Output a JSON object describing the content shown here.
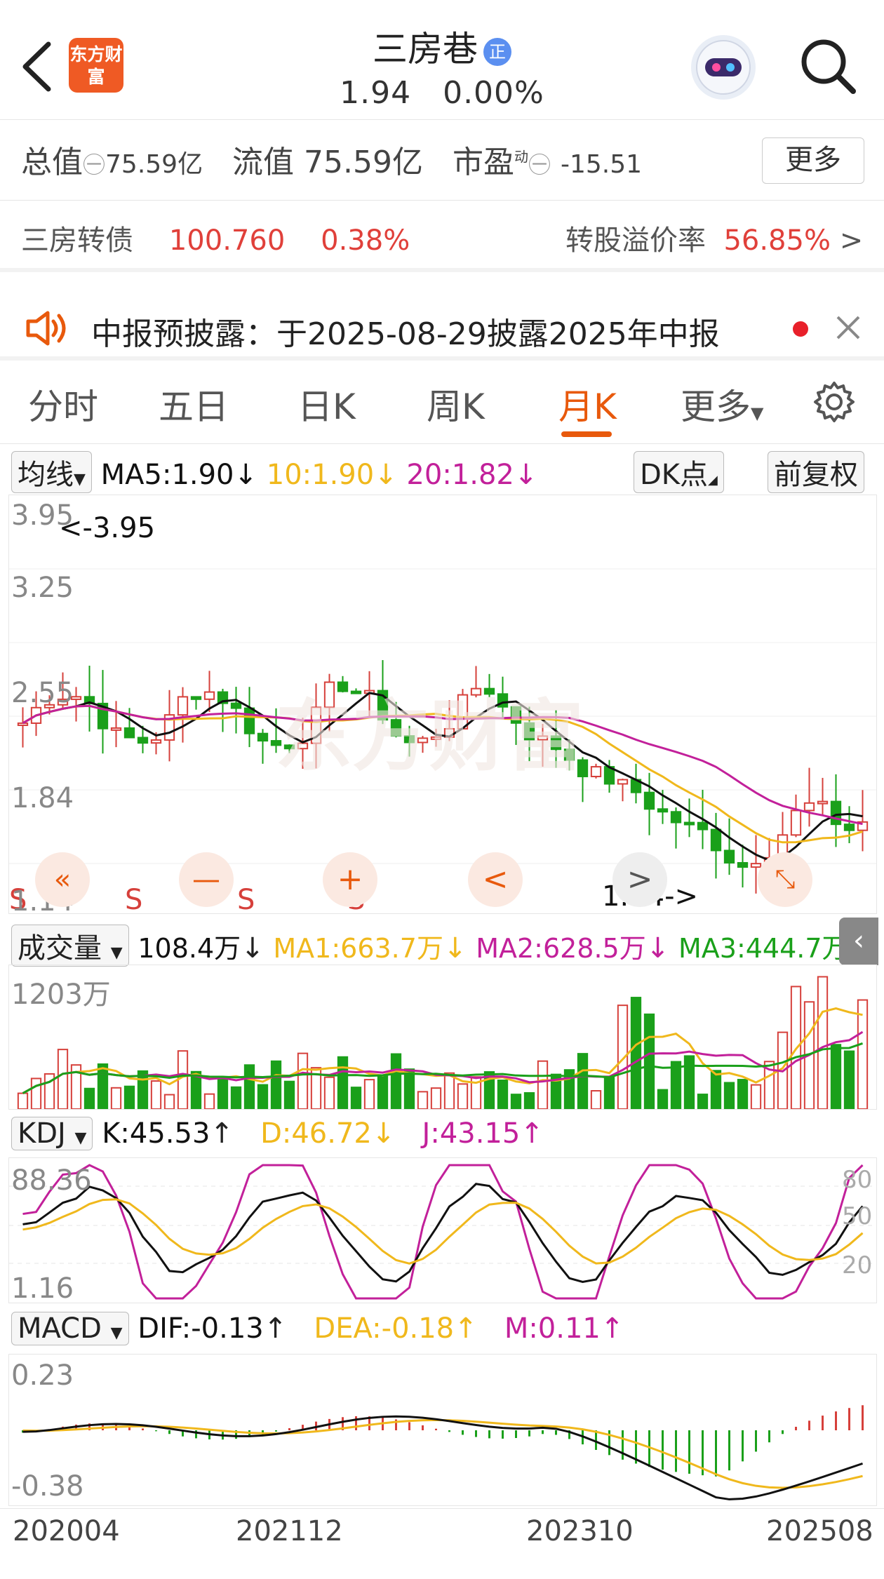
{
  "header": {
    "logo_text": "东方财富",
    "stock_name": "三房巷",
    "badge": "正",
    "price": "1.94",
    "change_pct": "0.00%"
  },
  "stats": {
    "total_label": "总值",
    "total_value": "75.59亿",
    "float_label": "流值",
    "float_value": "75.59亿",
    "pe_label": "市盈",
    "pe_sup": "动",
    "pe_value": "-15.51",
    "more_label": "更多"
  },
  "bond": {
    "name": "三房转债",
    "price": "100.760",
    "change": "0.38%",
    "premium_label": "转股溢价率",
    "premium_value": "56.85%"
  },
  "notice": {
    "text": "中报预披露：于2025-08-29披露2025年中报"
  },
  "tabs": [
    "分时",
    "五日",
    "日K",
    "周K",
    "月K",
    "更多"
  ],
  "active_tab": "月K",
  "ma_row": {
    "selector": "均线",
    "ma5": "MA5:1.90",
    "ma10": "10:1.90",
    "ma20": "20:1.82",
    "dk_label": "DK点",
    "adjust_label": "前复权"
  },
  "kline": {
    "y_labels": [
      "3.95",
      "3.25",
      "2.55",
      "1.84",
      "1.14"
    ],
    "high_marker": "<-3.95",
    "low_marker": "1.14->",
    "watermark": "东方财富"
  },
  "volume_row": {
    "selector": "成交量",
    "value": "108.4万",
    "ma1": "MA1:663.7万",
    "ma2": "MA2:628.5万",
    "ma3": "MA3:444.7万",
    "y_label": "1203万"
  },
  "kdj_row": {
    "selector": "KDJ",
    "k": "K:45.53",
    "d": "D:46.72",
    "j": "J:43.15",
    "y_top": "88.36",
    "y_bottom": "1.16",
    "levels": [
      "80",
      "50",
      "20"
    ]
  },
  "macd_row": {
    "selector": "MACD",
    "dif": "DIF:-0.13",
    "dea": "DEA:-0.18",
    "m": "M:0.11",
    "y_top": "0.23",
    "y_bottom": "-0.38"
  },
  "x_axis": [
    "202004",
    "202112",
    "202310",
    "202508"
  ],
  "colors": {
    "up": "#d6403b",
    "down": "#1aa01a",
    "ma5": "#111111",
    "ma10": "#f0b81c",
    "ma20": "#c2209a",
    "accent": "#e8590c"
  }
}
